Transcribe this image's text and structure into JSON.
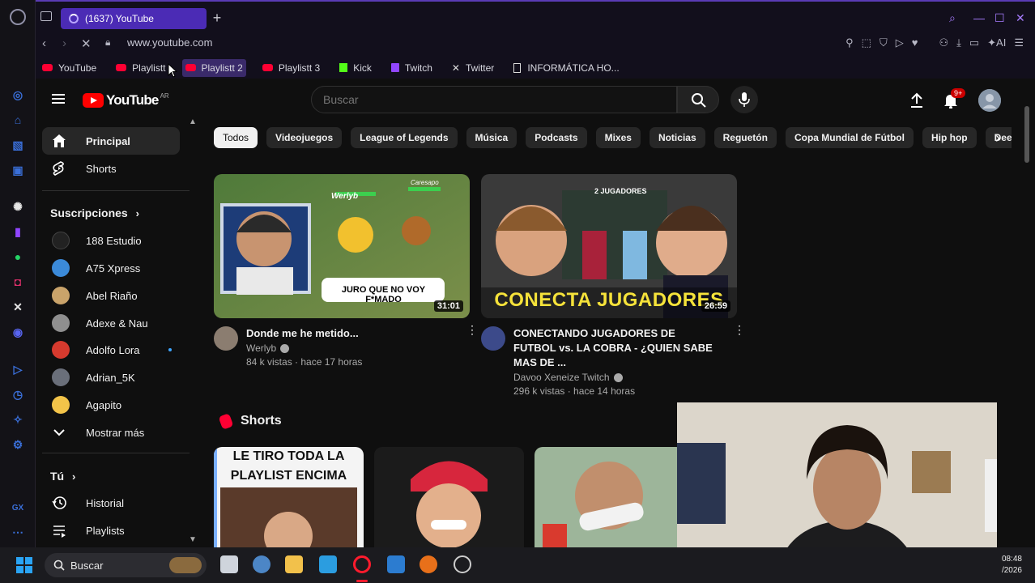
{
  "browser": {
    "tab_title": "(1637) YouTube",
    "url": "www.youtube.com",
    "ai_label": "AI",
    "bookmarks": [
      {
        "label": "YouTube",
        "icon": "youtube-icon"
      },
      {
        "label": "Playlistt",
        "icon": "youtube-icon"
      },
      {
        "label": "Playlistt 2",
        "icon": "youtube-icon"
      },
      {
        "label": "Playlistt 3",
        "icon": "youtube-icon"
      },
      {
        "label": "Kick",
        "icon": "kick-icon"
      },
      {
        "label": "Twitch",
        "icon": "twitch-icon"
      },
      {
        "label": "Twitter",
        "icon": "x-icon"
      },
      {
        "label": "INFORMÁTICA HO...",
        "icon": "document-icon"
      }
    ],
    "rail_gx_label": "GX",
    "accent_color": "#5a3bb5"
  },
  "youtube": {
    "logo_text": "YouTube",
    "country_code": "AR",
    "search_placeholder": "Buscar",
    "notification_count": "9+",
    "sidebar": {
      "main": [
        {
          "label": "Principal",
          "icon": "home-icon"
        },
        {
          "label": "Shorts",
          "icon": "shorts-icon"
        }
      ],
      "subscriptions_title": "Suscripciones",
      "subscriptions": [
        {
          "label": "188 Estudio",
          "color": "#222222",
          "live": false
        },
        {
          "label": "A75 Xpress",
          "color": "#3b8ad9",
          "live": false
        },
        {
          "label": "Abel Riaño",
          "color": "#c9a36a",
          "live": false
        },
        {
          "label": "Adexe & Nau",
          "color": "#8f8f8f",
          "live": false
        },
        {
          "label": "Adolfo Lora",
          "color": "#d63a2e",
          "live": true
        },
        {
          "label": "Adrian_5K",
          "color": "#6a6f7a",
          "live": false
        },
        {
          "label": "Agapito",
          "color": "#f3c449",
          "live": false
        }
      ],
      "show_more": "Mostrar más",
      "you_title": "Tú",
      "you_items": [
        {
          "label": "Historial",
          "icon": "history-icon"
        },
        {
          "label": "Playlists",
          "icon": "playlists-icon"
        }
      ]
    },
    "chips": [
      "Todos",
      "Videojuegos",
      "League of Legends",
      "Música",
      "Podcasts",
      "Mixes",
      "Noticias",
      "Reguetón",
      "Copa Mundial de Fútbol",
      "Hip hop",
      "Deep house"
    ],
    "videos": [
      {
        "title": "Donde me he metido...",
        "channel": "Werlyb",
        "stats": "84 k vistas · hace 17 horas",
        "duration": "31:01",
        "thumb_caption": "JURO QUE NO VOY F*MADO",
        "thumb_tag_1": "Werlyb",
        "thumb_tag_2": "Caresapo"
      },
      {
        "title": "CONECTANDO JUGADORES DE FUTBOL vs. LA COBRA - ¿QUIEN SABE MAS DE ...",
        "channel": "Davoo Xeneize Twitch",
        "stats": "296 k vistas · hace 14 horas",
        "duration": "26:59",
        "thumb_caption": "CONECTA JUGADORES",
        "thumb_tag_1": "2 JUGADORES"
      }
    ],
    "shorts_title": "Shorts",
    "shorts": [
      {
        "caption": "LE TIRO TODA LA PLAYLIST ENCIMA"
      },
      {
        "caption": ""
      },
      {
        "caption": ""
      }
    ]
  },
  "taskbar": {
    "search_label": "Buscar",
    "time": "08:48",
    "date": "/2026"
  }
}
